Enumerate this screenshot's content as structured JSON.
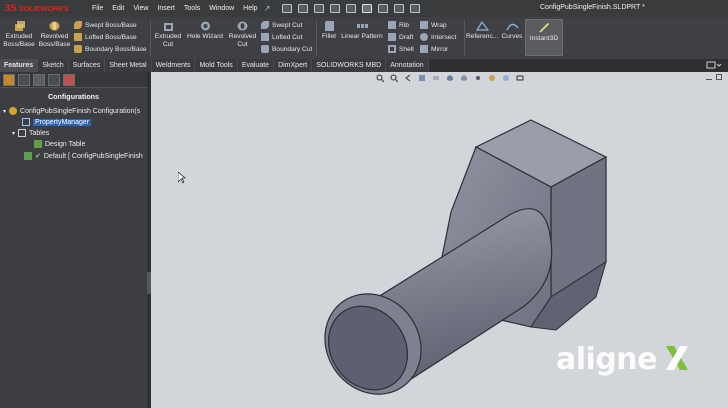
{
  "app": {
    "brand_ds": "3S",
    "brand_name": "SOLIDWORKS",
    "document_title": "ConfigPubSingleFinish.SLDPRT *"
  },
  "menu": [
    "File",
    "Edit",
    "View",
    "Insert",
    "Tools",
    "Window",
    "Help"
  ],
  "ribbon": {
    "extruded_boss": "Extruded Boss/Base",
    "revolved_boss": "Revolved Boss/Base",
    "swept_boss": "Swept Boss/Base",
    "lofted_boss": "Lofted Boss/Base",
    "boundary_boss": "Boundary Boss/Base",
    "extruded_cut": "Extruded Cut",
    "hole_wizard": "Hole Wizard",
    "revolved_cut": "Revolved Cut",
    "swept_cut": "Swept Cut",
    "lofted_cut": "Lofted Cut",
    "boundary_cut": "Boundary Cut",
    "fillet": "Fillet",
    "linear_pattern": "Linear Pattern",
    "rib": "Rib",
    "draft": "Draft",
    "shell": "Shell",
    "wrap": "Wrap",
    "intersect": "Intersect",
    "mirror": "Mirror",
    "reference": "Referenc...",
    "curves": "Curves",
    "instant3d": "Instant3D"
  },
  "tabs": [
    {
      "label": "Features",
      "active": true
    },
    {
      "label": "Sketch",
      "active": false
    },
    {
      "label": "Surfaces",
      "active": false
    },
    {
      "label": "Sheet Metal",
      "active": false
    },
    {
      "label": "Weldments",
      "active": false
    },
    {
      "label": "Mold Tools",
      "active": false
    },
    {
      "label": "Evaluate",
      "active": false
    },
    {
      "label": "DimXpert",
      "active": false
    },
    {
      "label": "SOLIDWORKS MBD",
      "active": false
    },
    {
      "label": "Annotation",
      "active": false
    }
  ],
  "panel": {
    "title": "Configurations",
    "tree": {
      "root": "ConfigPubSingleFinish Configuration(s",
      "property_manager": "PropertyManager",
      "tables": "Tables",
      "design_table": "Design Table",
      "default": "Default [ ConfigPubSingleFinish"
    }
  },
  "watermark": {
    "text": "aligne"
  },
  "colors": {
    "accent_selection": "#2f63b3",
    "brand_red": "#e2231a",
    "viewport_bg": "#d2d5d9",
    "part_face": "#8e929f",
    "watermark_green": "#7fbf3f"
  }
}
